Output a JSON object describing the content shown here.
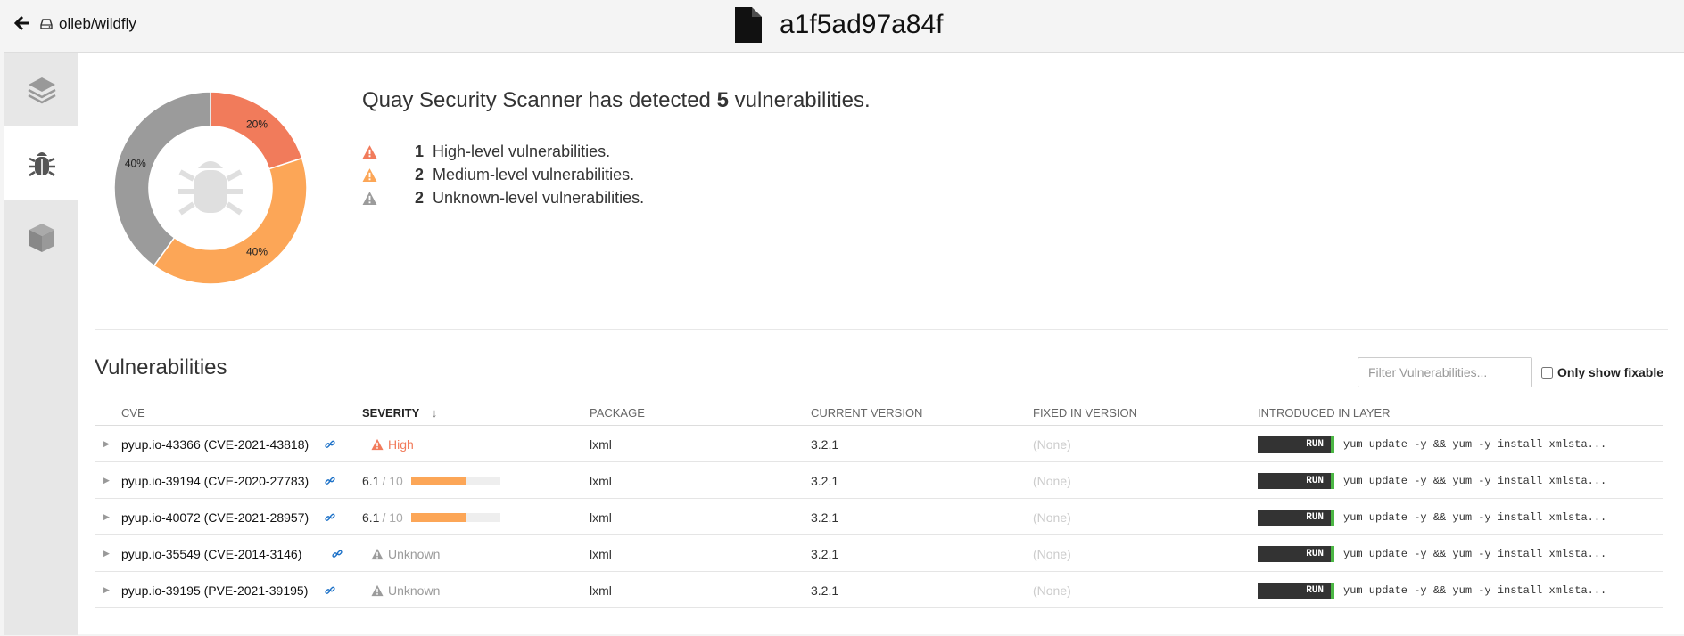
{
  "header": {
    "repo": "olleb/wildfly",
    "digest": "a1f5ad97a84f"
  },
  "sidebar": {
    "tabs": [
      {
        "name": "layers",
        "icon": "layers-icon"
      },
      {
        "name": "security",
        "icon": "bug-icon",
        "active": true
      },
      {
        "name": "packages",
        "icon": "package-icon"
      }
    ]
  },
  "summary": {
    "prefix": "Quay Security Scanner has detected",
    "count": "5",
    "suffix": "vulnerabilities.",
    "levels": [
      {
        "count": "1",
        "label": "High-level vulnerabilities.",
        "color": "#f17b5b"
      },
      {
        "count": "2",
        "label": "Medium-level vulnerabilities.",
        "color": "#fca657"
      },
      {
        "count": "2",
        "label": "Unknown-level vulnerabilities.",
        "color": "#9b9b9b"
      }
    ]
  },
  "chart_data": {
    "type": "pie",
    "categories": [
      "High",
      "Medium",
      "Unknown"
    ],
    "values": [
      20,
      40,
      40
    ],
    "labels": [
      "20%",
      "40%",
      "40%"
    ],
    "colors": [
      "#f17b5b",
      "#fca657",
      "#9b9b9b"
    ]
  },
  "vulns": {
    "title": "Vulnerabilities",
    "filter_placeholder": "Filter Vulnerabilities...",
    "only_fixable": "Only show fixable",
    "columns": [
      "CVE",
      "SEVERITY",
      "PACKAGE",
      "CURRENT VERSION",
      "FIXED IN VERSION",
      "INTRODUCED IN LAYER"
    ],
    "sort_arrow": "↓",
    "rows": [
      {
        "cve": "pyup.io-43366 (CVE-2021-43818)",
        "severity": "High",
        "score": null,
        "package": "lxml",
        "current": "3.2.1",
        "fixed": "(None)",
        "run": "RUN",
        "layer": "yum update -y && yum -y install xmlsta..."
      },
      {
        "cve": "pyup.io-39194 (CVE-2020-27783)",
        "severity": null,
        "score": "6.1",
        "max": "/ 10",
        "score_fraction": 0.61,
        "package": "lxml",
        "current": "3.2.1",
        "fixed": "(None)",
        "run": "RUN",
        "layer": "yum update -y && yum -y install xmlsta..."
      },
      {
        "cve": "pyup.io-40072 (CVE-2021-28957)",
        "severity": null,
        "score": "6.1",
        "max": "/ 10",
        "score_fraction": 0.61,
        "package": "lxml",
        "current": "3.2.1",
        "fixed": "(None)",
        "run": "RUN",
        "layer": "yum update -y && yum -y install xmlsta..."
      },
      {
        "cve": "pyup.io-35549 (CVE-2014-3146)",
        "severity": "Unknown",
        "score": null,
        "package": "lxml",
        "current": "3.2.1",
        "fixed": "(None)",
        "run": "RUN",
        "layer": "yum update -y && yum -y install xmlsta..."
      },
      {
        "cve": "pyup.io-39195 (PVE-2021-39195)",
        "severity": "Unknown",
        "score": null,
        "package": "lxml",
        "current": "3.2.1",
        "fixed": "(None)",
        "run": "RUN",
        "layer": "yum update -y && yum -y install xmlsta..."
      }
    ]
  },
  "colors": {
    "high": "#f17b5b",
    "medium": "#fca657",
    "unknown": "#9b9b9b",
    "link": "#1e72c8",
    "run_accent": "#4cb745"
  }
}
